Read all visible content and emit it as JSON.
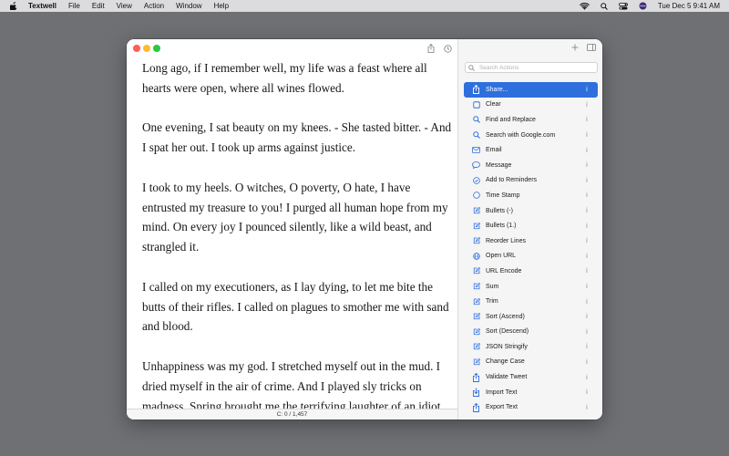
{
  "menubar": {
    "app_name": "Textwell",
    "items": [
      "File",
      "Edit",
      "View",
      "Action",
      "Window",
      "Help"
    ],
    "clock": "Tue Dec 5  9:41 AM"
  },
  "editor": {
    "paragraphs": [
      "Long ago, if I remember well, my life was a feast where all hearts were open, where all wines flowed.",
      "One evening, I sat beauty on my knees. - She tasted bitter. - And I spat her out. I took up arms against justice.",
      "I took to my heels. O witches, O poverty, O hate, I have entrusted my treasure to you! I purged all human hope from my mind. On every joy I pounced silently, like a wild beast, and strangled it.",
      "I called on my executioners, as I lay dying, to let me bite the butts of their rifles. I called on plagues to smother me with sand and blood.",
      "Unhappiness was my god. I stretched myself out in the mud. I dried myself in the air of crime. And I played sly tricks on madness. Spring brought me the terrifying laughter of an idiot."
    ],
    "status": "C: 0 / 1,457"
  },
  "sidebar": {
    "search_placeholder": "Search Actions",
    "search_value": "",
    "info_glyph": "i",
    "actions": [
      {
        "label": "Share...",
        "icon": "share-icon",
        "selected": true
      },
      {
        "label": "Clear",
        "icon": "square-icon"
      },
      {
        "label": "Find and Replace",
        "icon": "magnifier-icon"
      },
      {
        "label": "Search with Google.com",
        "icon": "magnifier-icon"
      },
      {
        "label": "Email",
        "icon": "envelope-icon"
      },
      {
        "label": "Message",
        "icon": "message-bubble-icon"
      },
      {
        "label": "Add to Reminders",
        "icon": "checkmark-circle-icon"
      },
      {
        "label": "Time Stamp",
        "icon": "circle-icon"
      },
      {
        "label": "Bullets (-)",
        "icon": "edit-icon"
      },
      {
        "label": "Bullets (1.)",
        "icon": "edit-icon"
      },
      {
        "label": "Reorder Lines",
        "icon": "edit-icon"
      },
      {
        "label": "Open URL",
        "icon": "globe-icon"
      },
      {
        "label": "URL Encode",
        "icon": "edit-icon"
      },
      {
        "label": "Sum",
        "icon": "edit-icon"
      },
      {
        "label": "Trim",
        "icon": "edit-icon"
      },
      {
        "label": "Sort (Ascend)",
        "icon": "edit-icon"
      },
      {
        "label": "Sort (Descend)",
        "icon": "edit-icon"
      },
      {
        "label": "JSON Stringify",
        "icon": "edit-icon"
      },
      {
        "label": "Change Case",
        "icon": "edit-icon"
      },
      {
        "label": "Validate Tweet",
        "icon": "share-icon"
      },
      {
        "label": "Import Text",
        "icon": "import-icon"
      },
      {
        "label": "Export Text",
        "icon": "share-icon"
      }
    ]
  },
  "colors": {
    "accent": "#2f6fdd",
    "desktop": "#6e7074",
    "icon_blue": "#2f6fdd"
  }
}
